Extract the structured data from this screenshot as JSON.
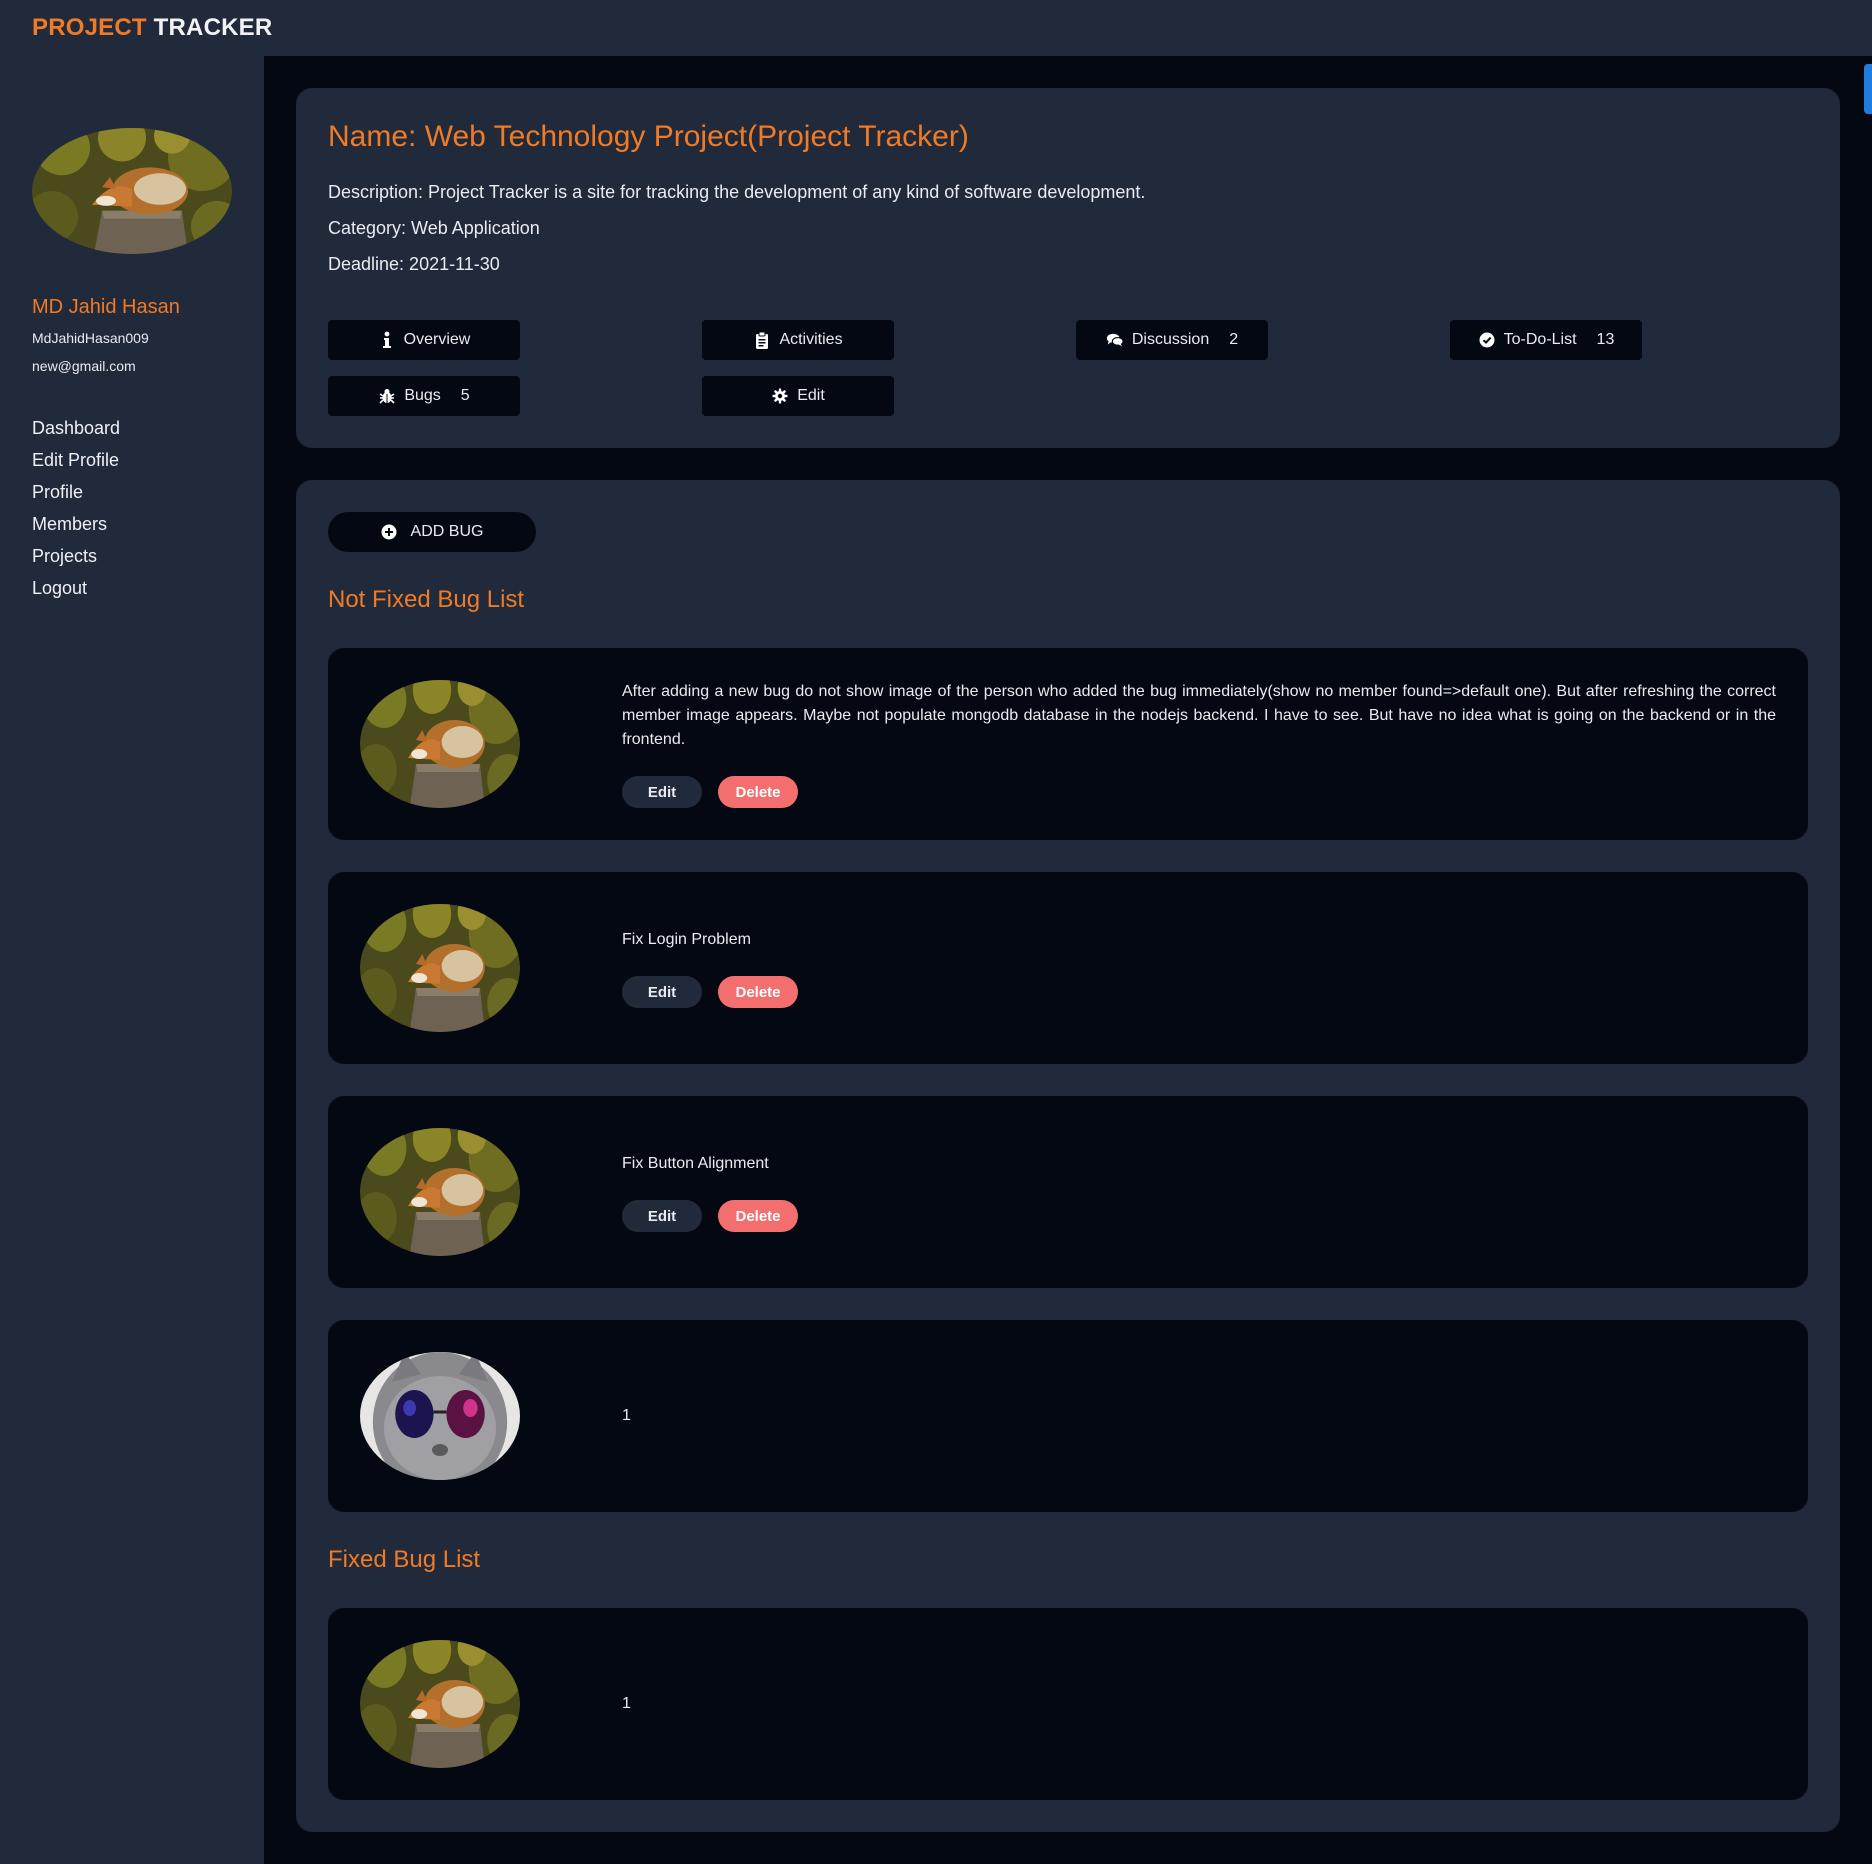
{
  "brand": {
    "part1": "PROJECT",
    "part2": "TRACKER"
  },
  "user": {
    "name": "MD Jahid Hasan",
    "handle": "MdJahidHasan009",
    "email": "new@gmail.com",
    "avatar": "fox-avatar"
  },
  "nav": [
    "Dashboard",
    "Edit Profile",
    "Profile",
    "Members",
    "Projects",
    "Logout"
  ],
  "project": {
    "title": "Name: Web Technology Project(Project Tracker)",
    "description": "Description: Project Tracker is a site for tracking the development of any kind of software development.",
    "category": "Category: Web Application",
    "deadline": "Deadline: 2021-11-30"
  },
  "actions": {
    "overview": {
      "label": "Overview",
      "icon": "info-icon"
    },
    "activities": {
      "label": "Activities",
      "icon": "clipboard-icon"
    },
    "discussion": {
      "label": "Discussion",
      "count": "2",
      "icon": "comments-icon"
    },
    "todo": {
      "label": "To-Do-List",
      "count": "13",
      "icon": "check-circle-icon"
    },
    "bugs": {
      "label": "Bugs",
      "count": "5",
      "icon": "bug-icon"
    },
    "edit": {
      "label": "Edit",
      "icon": "gear-icon"
    }
  },
  "add_bug_label": "ADD BUG",
  "not_fixed_title": "Not Fixed Bug List",
  "fixed_title": "Fixed Bug List",
  "bug_edit_label": "Edit",
  "bug_delete_label": "Delete",
  "not_fixed_bugs": [
    {
      "text": "After adding a new bug do not show image of the person who added the bug immediately(show no member found=>default one). But after refreshing the correct member image appears. Maybe not populate mongodb database in the nodejs backend. I have to see. But have no idea what is going on the backend or in the frontend.",
      "avatar": "fox-avatar"
    },
    {
      "text": "Fix Login Problem",
      "avatar": "fox-avatar"
    },
    {
      "text": "Fix Button Alignment",
      "avatar": "fox-avatar"
    },
    {
      "text": "1",
      "avatar": "cat-avatar"
    }
  ],
  "fixed_bugs": [
    {
      "text": "1",
      "avatar": "fox-avatar"
    }
  ],
  "colors": {
    "accent": "#f07a25",
    "panel": "#212a3a",
    "background": "#040812",
    "danger": "#f36e6e"
  }
}
